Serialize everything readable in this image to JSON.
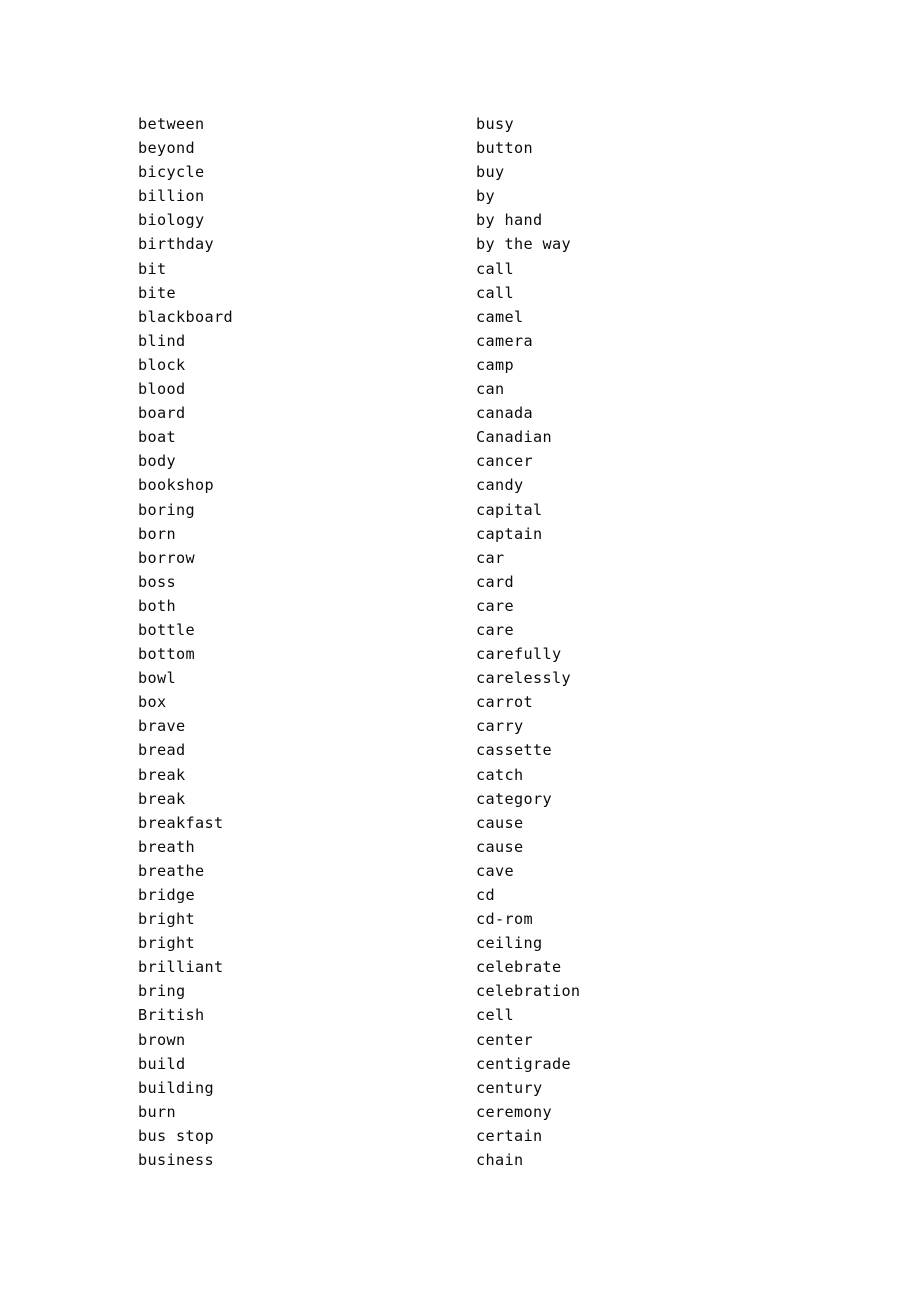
{
  "document": {
    "type": "word-list",
    "background_color": "#ffffff",
    "text_color": "#000000",
    "columns": 2,
    "rows": 44
  },
  "word_list": {
    "left_column": [
      "between",
      "beyond",
      "bicycle",
      "billion",
      "biology",
      "birthday",
      "bit",
      "bite",
      "blackboard",
      "blind",
      "block",
      "blood",
      "board",
      "boat",
      "body",
      "bookshop",
      "boring",
      "born",
      "borrow",
      "boss",
      "both",
      "bottle",
      "bottom",
      "bowl",
      "box",
      "brave",
      "bread",
      "break",
      "break",
      "breakfast",
      "breath",
      "breathe",
      "bridge",
      "bright",
      "bright",
      "brilliant",
      "bring",
      "British",
      "brown",
      "build",
      "building",
      "burn",
      "bus stop",
      "business"
    ],
    "right_column": [
      "busy",
      "button",
      "buy",
      "by",
      "by hand",
      "by the way",
      "call",
      "call",
      "camel",
      "camera",
      "camp",
      "can",
      "canada",
      "Canadian",
      "cancer",
      "candy",
      "capital",
      "captain",
      "car",
      "card",
      "care",
      "care",
      "carefully",
      "carelessly",
      "carrot",
      "carry",
      "cassette",
      "catch",
      "category",
      "cause",
      "cause",
      "cave",
      "cd",
      "cd-rom",
      "ceiling",
      "celebrate",
      "celebration",
      "cell",
      "center",
      "centigrade",
      "century",
      "ceremony",
      "certain",
      "chain"
    ]
  }
}
